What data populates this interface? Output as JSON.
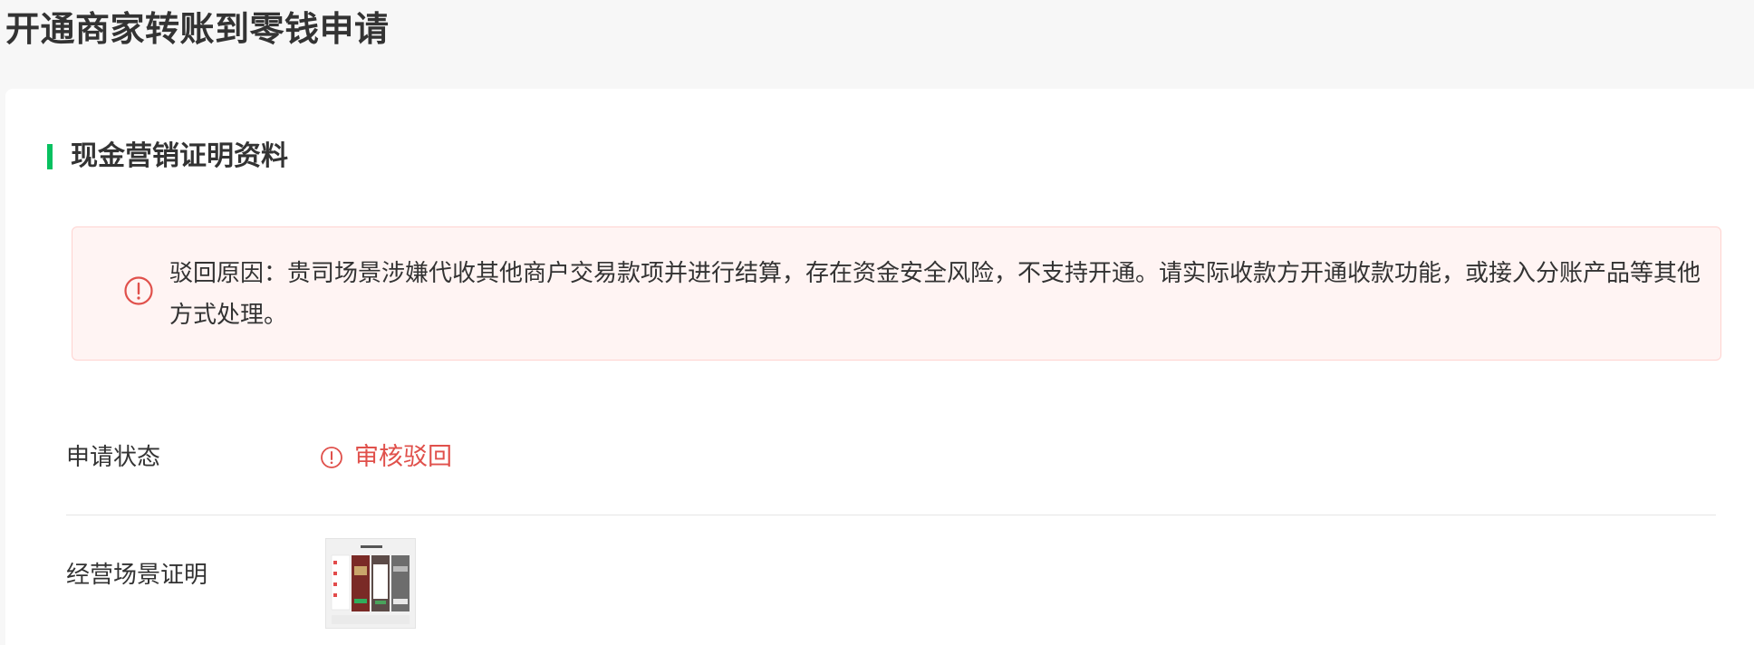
{
  "page": {
    "title": "开通商家转账到零钱申请"
  },
  "section": {
    "title": "现金营销证明资料"
  },
  "alert": {
    "icon": "exclamation-circle-icon",
    "message": "驳回原因：贵司场景涉嫌代收其他商户交易款项并进行结算，存在资金安全风险，不支持开通。请实际收款方开通收款功能，或接入分账产品等其他方式处理。"
  },
  "fields": {
    "status": {
      "label": "申请状态",
      "value": "审核驳回",
      "icon": "exclamation-circle-icon"
    },
    "scene_proof": {
      "label": "经营场景证明",
      "image": "business-scene-thumbnail"
    }
  },
  "colors": {
    "accent": "#07c160",
    "error": "#e0504b",
    "alert_bg": "#fff4f3",
    "alert_border": "#ffd3d0"
  }
}
